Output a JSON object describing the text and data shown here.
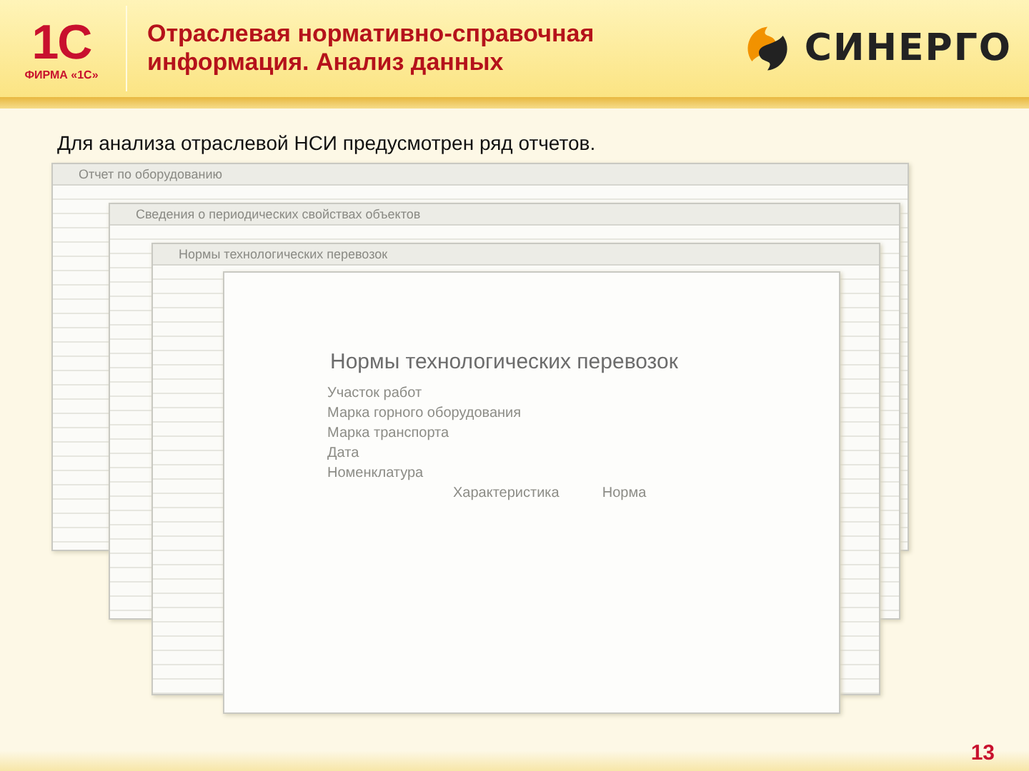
{
  "header": {
    "logo_text": "1С",
    "logo_caption": "ФИРМА «1С»",
    "title": "Отраслевая нормативно-справочная информация. Анализ данных",
    "partner_name": "СИНЕРГО"
  },
  "intro": "Для анализа отраслевой НСИ предусмотрен ряд отчетов.",
  "windows": [
    {
      "title": "Отчет по оборудованию"
    },
    {
      "title": "Сведения о периодических свойствах объектов"
    },
    {
      "title": "Нормы технологических перевозок"
    }
  ],
  "report": {
    "title": "Нормы технологических перевозок",
    "fields": [
      "Участок работ",
      "Марка горного оборудования",
      "Марка транспорта",
      "Дата",
      "Номенклатура"
    ],
    "columns": [
      "Характеристика",
      "Норма"
    ]
  },
  "page_number": "13"
}
